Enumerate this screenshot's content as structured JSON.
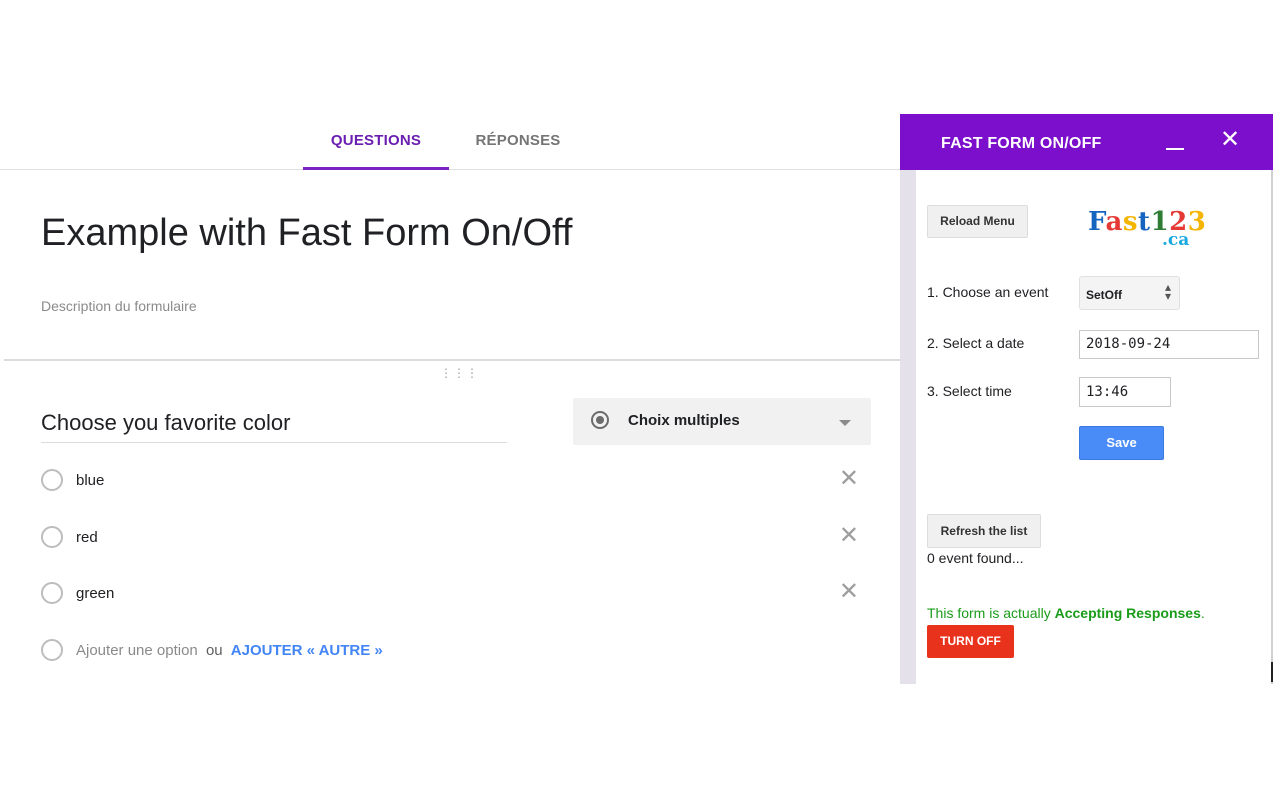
{
  "tabs": {
    "questions": "QUESTIONS",
    "responses": "RÉPONSES"
  },
  "form": {
    "title": "Example with Fast Form On/Off",
    "description": "Description du formulaire"
  },
  "question": {
    "drag_handle": "⋮⋮⋮",
    "title": "Choose you favorite color",
    "type_label": "Choix multiples",
    "options": [
      "blue",
      "red",
      "green"
    ],
    "delete_symbol": "✕",
    "add_option": "Ajouter une option",
    "or": "ou",
    "add_other": "AJOUTER « AUTRE »"
  },
  "panel": {
    "title": "FAST FORM ON/OFF",
    "close_symbol": "✕",
    "reload_button": "Reload Menu",
    "logo": {
      "letters": [
        {
          "ch": "F",
          "color": "#1565c0"
        },
        {
          "ch": "a",
          "color": "#e53935"
        },
        {
          "ch": "s",
          "color": "#f4b400"
        },
        {
          "ch": "t",
          "color": "#1565c0"
        },
        {
          "ch": "1",
          "color": "#2e7d32"
        },
        {
          "ch": "2",
          "color": "#e53935"
        },
        {
          "ch": "3",
          "color": "#f4b400"
        }
      ],
      "sub": ".ca"
    },
    "step1_label": "1. Choose an event",
    "event_value": "SetOff",
    "step2_label": "2. Select a date",
    "date_value": "2018-09-24",
    "step3_label": "3. Select time",
    "time_value": "13:46",
    "save_button": "Save",
    "refresh_button": "Refresh the list",
    "events_found": "0 event found...",
    "status_prefix": "This form is actually ",
    "status_strong": "Accepting Responses",
    "status_suffix": ".",
    "turn_off_button": "TURN OFF"
  },
  "colors": {
    "accent_purple": "#7b0fcb",
    "tab_active": "#6a1fb0",
    "save_blue": "#4a8cf7",
    "turn_off_red": "#e8321c",
    "status_green": "#1a9c1a",
    "link_blue": "#4285f4"
  }
}
